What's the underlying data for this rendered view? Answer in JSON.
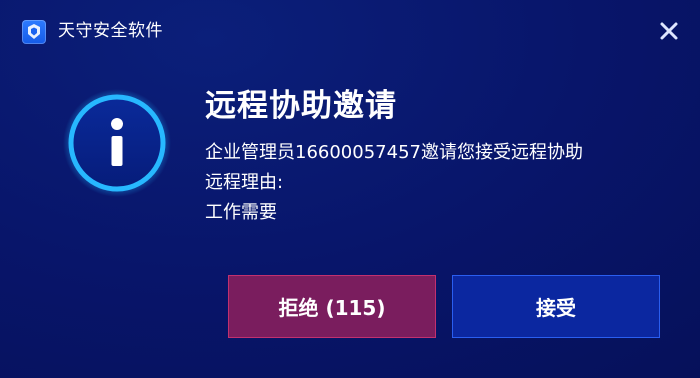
{
  "window": {
    "app_title": "天守安全软件",
    "app_icon": "app-logo-icon",
    "close_icon": "close-icon"
  },
  "dialog": {
    "icon": "info-icon",
    "title": "远程协助邀请",
    "message_line1": "企业管理员16600057457邀请您接受远程协助",
    "message_line2": "远程理由:",
    "message_line3": "工作需要"
  },
  "buttons": {
    "reject_label": "拒绝 (115)",
    "accept_label": "接受"
  },
  "colors": {
    "background": "#08156a",
    "reject_bg": "#7a1d5e",
    "reject_border": "#c2306f",
    "accept_bg": "#0b27a0",
    "accept_border": "#2a5ef0",
    "icon_ring": "#1fb4ff"
  }
}
